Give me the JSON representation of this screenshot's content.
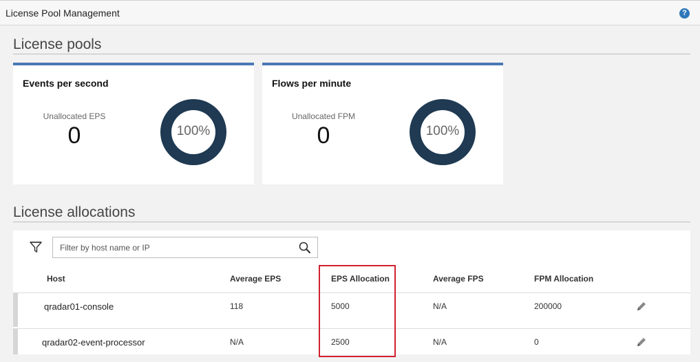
{
  "window": {
    "title": "License Pool Management",
    "help_icon": "help-icon",
    "help_glyph": "?"
  },
  "pools": {
    "section_title": "License pools",
    "cards": [
      {
        "title": "Events per second",
        "metric_label": "Unallocated EPS",
        "metric_value": "0",
        "percent_label": "100%",
        "percent_value": 100
      },
      {
        "title": "Flows per minute",
        "metric_label": "Unallocated FPM",
        "metric_value": "0",
        "percent_label": "100%",
        "percent_value": 100
      }
    ],
    "accent_color": "#4a78b4",
    "donut_color": "#1f3a52"
  },
  "allocations": {
    "section_title": "License allocations",
    "filter_icon": "filter-icon",
    "search": {
      "placeholder": "Filter by host name or IP",
      "value": "",
      "icon": "search-icon"
    },
    "columns": [
      "Host",
      "Average EPS",
      "EPS Allocation",
      "Average FPS",
      "FPM Allocation"
    ],
    "rows": [
      {
        "host": "qradar01-console",
        "avg_eps": "118",
        "eps_allocation": "5000",
        "avg_fps": "N/A",
        "fpm_allocation": "200000",
        "action_icon": "pencil-icon"
      },
      {
        "host": "qradar02-event-processor",
        "avg_eps": "N/A",
        "eps_allocation": "2500",
        "avg_fps": "N/A",
        "fpm_allocation": "0",
        "action_icon": "pencil-icon"
      }
    ],
    "highlight_color": "#d0202e"
  }
}
